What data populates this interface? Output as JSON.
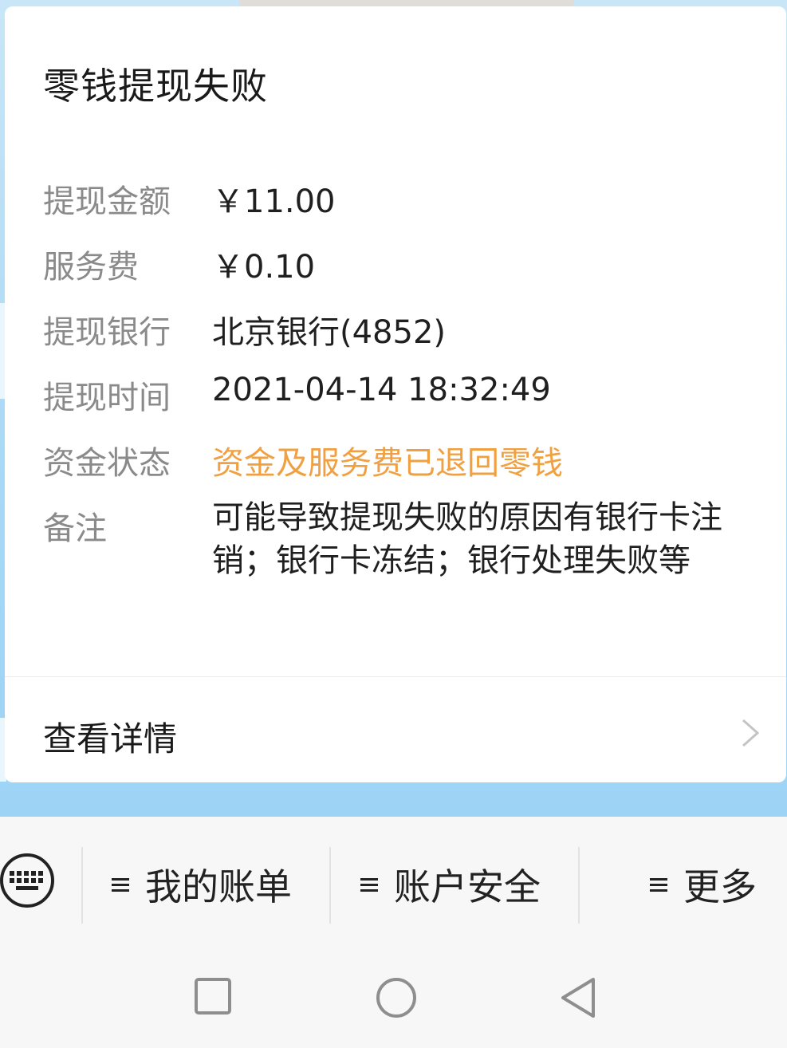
{
  "card": {
    "title": "零钱提现失败",
    "rows": [
      {
        "label": "提现金额",
        "value": "￥11.00"
      },
      {
        "label": "服务费",
        "value": "￥0.10"
      },
      {
        "label": "提现银行",
        "value": "北京银行(4852)"
      },
      {
        "label": "提现时间",
        "value": "2021-04-14 18:32:49"
      },
      {
        "label": "资金状态",
        "value": "资金及服务费已退回零钱"
      },
      {
        "label": "备注",
        "value": "可能导致提现失败的原因有银行卡注销；银行卡冻结；银行处理失败等"
      }
    ],
    "detail_label": "查看详情",
    "status_color": "#f0a040"
  },
  "menu": {
    "items": [
      {
        "label": "我的账单"
      },
      {
        "label": "账户安全"
      },
      {
        "label": "更多"
      }
    ]
  },
  "icons": {
    "keyboard": "keyboard-icon",
    "chevron": "chevron-right-icon",
    "hamburger": "menu-icon",
    "recent": "square-icon",
    "home": "circle-icon",
    "back": "triangle-back-icon"
  }
}
